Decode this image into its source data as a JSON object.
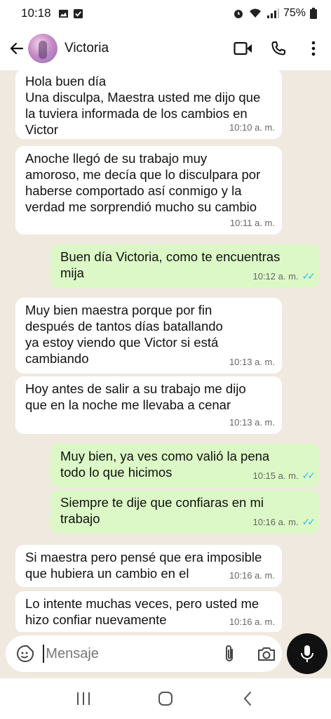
{
  "status_bar": {
    "time": "10:18",
    "battery": "75%",
    "icons": [
      "gallery-icon",
      "checkbox-icon",
      "alarm-icon",
      "wifi-icon",
      "signal-icon",
      "battery-icon"
    ]
  },
  "header": {
    "contact_name": "Victoria",
    "icons": [
      "back-arrow-icon",
      "video-call-icon",
      "phone-icon",
      "more-vert-icon"
    ]
  },
  "messages": [
    {
      "direction": "in",
      "text": "Hola buen día\nUna disculpa, Maestra usted me dijo que\nla tuviera informada de los cambios en\nVictor",
      "time": "10:10 a. m."
    },
    {
      "direction": "in",
      "text": "Anoche llegó de su trabajo muy\namoroso, me decía que lo disculpara por\nhaberse comportado así conmigo y la\nverdad me sorprendió mucho su cambio",
      "time": "10:11 a. m."
    },
    {
      "direction": "out",
      "text": "Buen día Victoria, como te encuentras\nmija",
      "time": "10:12 a. m.",
      "status": "read"
    },
    {
      "direction": "in",
      "text": "Muy bien maestra porque por fin\ndespués de tantos días batallando\nya estoy viendo que Victor si está\ncambiando",
      "time": "10:13 a. m."
    },
    {
      "direction": "in",
      "text": "Hoy antes de salir a su trabajo me dijo\nque en la noche me llevaba a cenar",
      "time": "10:13 a. m."
    },
    {
      "direction": "out",
      "text": "Muy bien, ya ves como valió la pena\ntodo lo que hicimos",
      "time": "10:15 a. m.",
      "status": "read"
    },
    {
      "direction": "out",
      "text": "Siempre te dije que confiaras en mi\ntrabajo",
      "time": "10:16 a. m.",
      "status": "read"
    },
    {
      "direction": "in",
      "text": "Si maestra pero pensé que era imposible\nque hubiera un cambio en el",
      "time": "10:16 a. m."
    },
    {
      "direction": "in",
      "text": "Lo intente muchas veces, pero usted me\nhizo confiar nuevamente",
      "time": "10:16 a. m."
    }
  ],
  "input": {
    "placeholder": "Mensaje",
    "value": "",
    "icons": [
      "emoji-sticker-icon",
      "attach-icon",
      "camera-icon",
      "mic-icon"
    ]
  },
  "nav_bar": {
    "icons": [
      "recent-apps-icon",
      "home-icon",
      "back-icon"
    ]
  },
  "colors": {
    "chat_background": "#efe9e0",
    "incoming_bubble": "#ffffff",
    "outgoing_bubble": "#dcf8c6",
    "read_ticks": "#34b7f1",
    "mic_button": "#111111"
  }
}
